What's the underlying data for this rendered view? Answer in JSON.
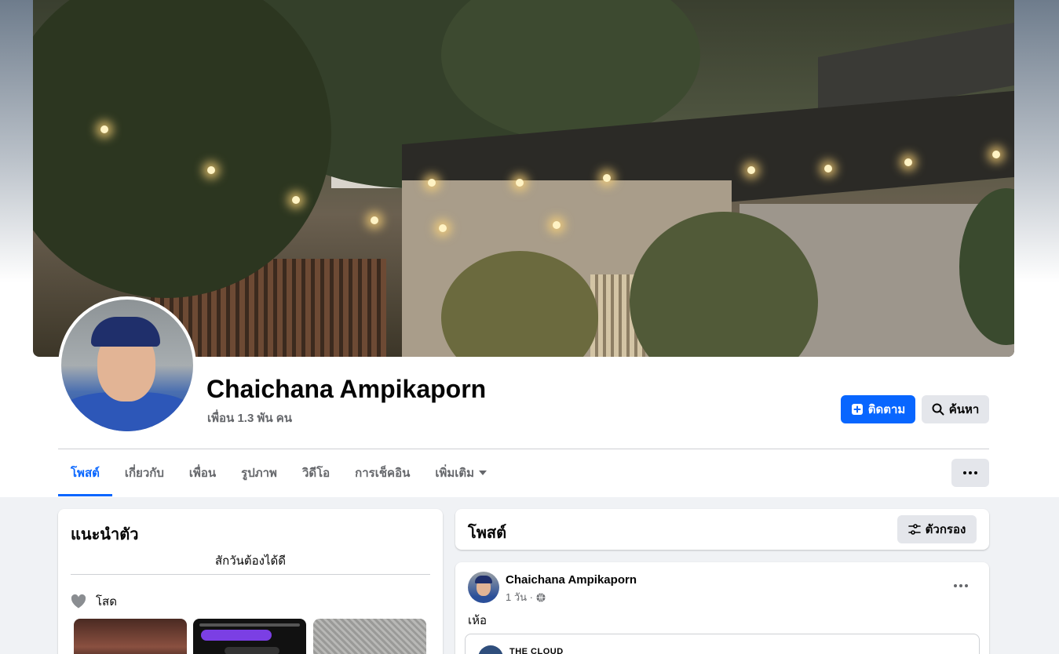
{
  "profile": {
    "name": "Chaichana Ampikaporn",
    "friends": "เพื่อน 1.3 พัน คน"
  },
  "actions": {
    "follow_label": "ติดตาม",
    "search_label": "ค้นหา"
  },
  "tabs": [
    {
      "label": "โพสต์",
      "active": true
    },
    {
      "label": "เกี่ยวกับ",
      "active": false
    },
    {
      "label": "เพื่อน",
      "active": false
    },
    {
      "label": "รูปภาพ",
      "active": false
    },
    {
      "label": "วิดีโอ",
      "active": false
    },
    {
      "label": "การเช็คอิน",
      "active": false
    },
    {
      "label": "เพิ่มเติม",
      "active": false
    }
  ],
  "intro": {
    "title": "แนะนำตัว",
    "bio": "สักวันต้องได้ดี",
    "relationship": "โสด"
  },
  "posts_section": {
    "title": "โพสต์",
    "filter_label": "ตัวกรอง"
  },
  "post": {
    "author": "Chaichana Ampikaporn",
    "time": "1 วัน ·",
    "text": "เห้อ",
    "shared_name": "THE CLOUD"
  },
  "colors": {
    "accent": "#0866ff",
    "secondary_button": "#e4e6eb",
    "page_background": "#f0f2f5",
    "muted_text": "#65676b"
  },
  "icons": {
    "follow": "follow-plus-icon",
    "search": "search-icon",
    "dropdown": "caret-down-icon",
    "more": "more-dots-icon",
    "relationship": "heart-icon",
    "filter": "filter-sliders-icon",
    "audience": "globe-icon"
  }
}
